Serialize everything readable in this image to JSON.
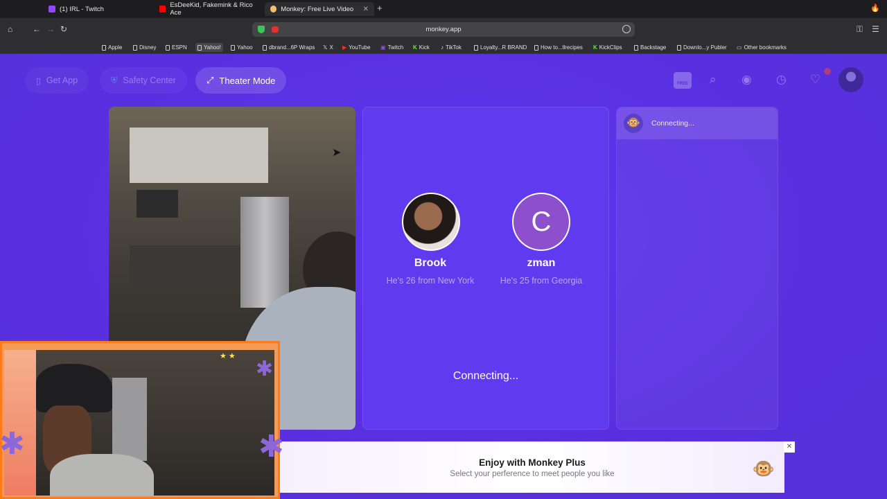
{
  "browser": {
    "tabs": [
      {
        "label": "(1) IRL - Twitch",
        "favicon_color": "#9146ff"
      },
      {
        "label": "EsDeeKid, Fakemink & Rico Ace",
        "favicon_color": "#ff0000"
      },
      {
        "label": "Monkey: Free Live Video C",
        "favicon_color": "#f0c070"
      }
    ],
    "url": "monkey.app",
    "bookmarks": [
      "Apple",
      "Disney",
      "ESPN",
      "Yahoo!",
      "Yahoo",
      "dbrand...6P Wraps",
      "X",
      "YouTube",
      "Twitch",
      "Kick",
      "TikTok",
      "Loyalty...R BRAND",
      "How to...llrecipes",
      "KickClips",
      "Backstage",
      "Downlo...y Publer",
      "Other bookmarks"
    ]
  },
  "app": {
    "nav": {
      "get_app": "Get App",
      "safety_center": "Safety Center",
      "theater_mode": "Theater Mode",
      "free_badge": "FREE"
    },
    "matches": [
      {
        "name": "Brook",
        "sub": "He's 26 from New York"
      },
      {
        "name": "zman",
        "initial": "C",
        "sub": "He's 25 from Georgia"
      }
    ],
    "connecting_status": "Connecting...",
    "chat": {
      "status": "Connecting..."
    },
    "plus_banner": {
      "title": "Enjoy with Monkey Plus",
      "subtitle": "Select your perference to meet people you like"
    }
  },
  "colors": {
    "accent": "#5a2fe0",
    "overlay_border": "#ff7a1a"
  }
}
